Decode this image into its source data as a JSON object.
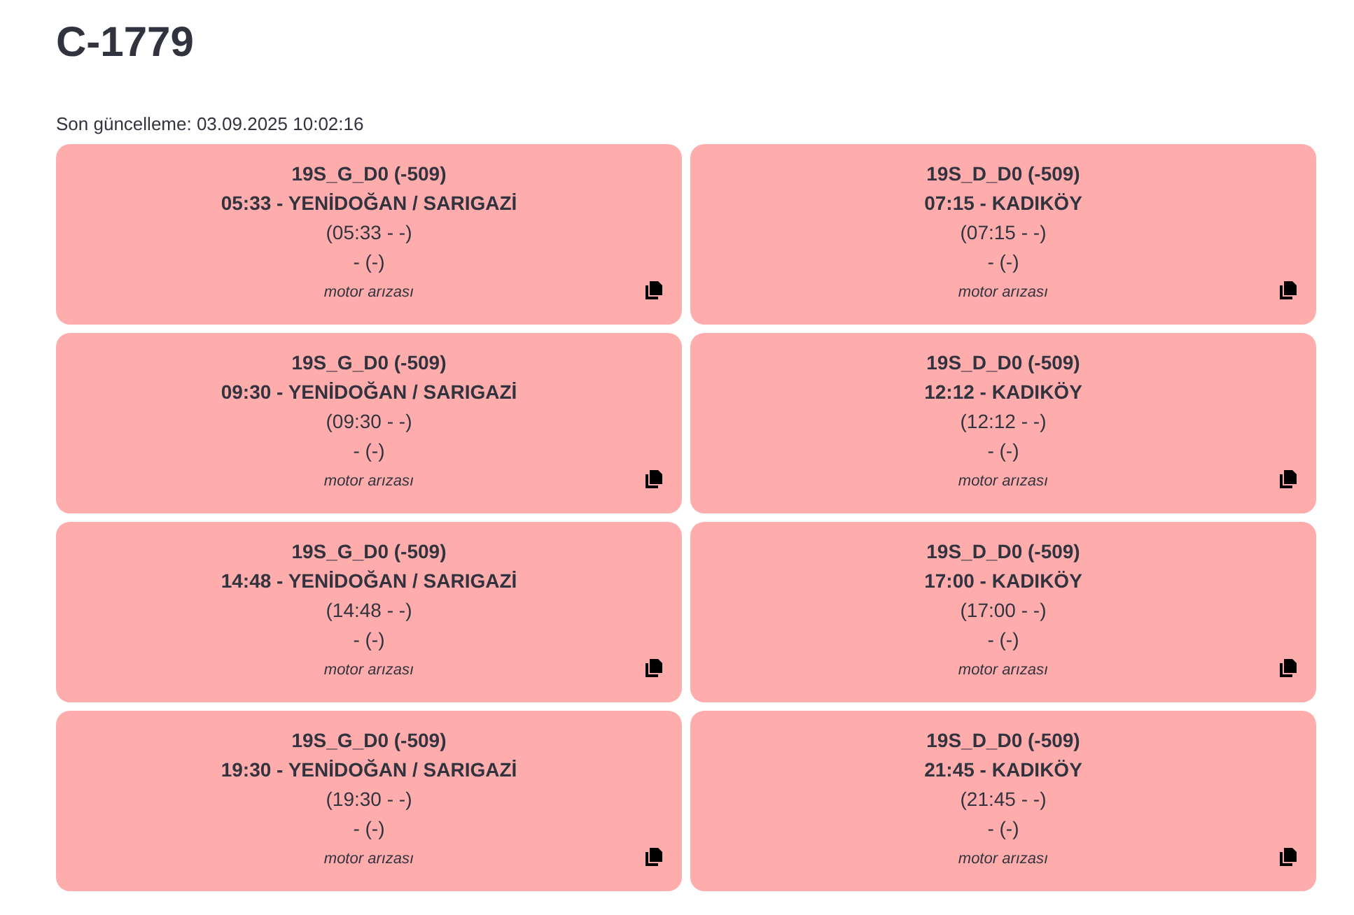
{
  "title": "C-1779",
  "last_update": "Son güncelleme: 03.09.2025 10:02:16",
  "cards": [
    {
      "code": "19S_G_D0 (-509)",
      "route": "05:33 - YENİDOĞAN / SARIGAZİ",
      "times": "(05:33 - -)",
      "detail": "- (-)",
      "note": "motor arızası"
    },
    {
      "code": "19S_D_D0 (-509)",
      "route": "07:15 - KADIKÖY",
      "times": "(07:15 - -)",
      "detail": "- (-)",
      "note": "motor arızası"
    },
    {
      "code": "19S_G_D0 (-509)",
      "route": "09:30 - YENİDOĞAN / SARIGAZİ",
      "times": "(09:30 - -)",
      "detail": "- (-)",
      "note": "motor arızası"
    },
    {
      "code": "19S_D_D0 (-509)",
      "route": "12:12 - KADIKÖY",
      "times": "(12:12 - -)",
      "detail": "- (-)",
      "note": "motor arızası"
    },
    {
      "code": "19S_G_D0 (-509)",
      "route": "14:48 - YENİDOĞAN / SARIGAZİ",
      "times": "(14:48 - -)",
      "detail": "- (-)",
      "note": "motor arızası"
    },
    {
      "code": "19S_D_D0 (-509)",
      "route": "17:00 - KADIKÖY",
      "times": "(17:00 - -)",
      "detail": "- (-)",
      "note": "motor arızası"
    },
    {
      "code": "19S_G_D0 (-509)",
      "route": "19:30 - YENİDOĞAN / SARIGAZİ",
      "times": "(19:30 - -)",
      "detail": "- (-)",
      "note": "motor arızası"
    },
    {
      "code": "19S_D_D0 (-509)",
      "route": "21:45 - KADIKÖY",
      "times": "(21:45 - -)",
      "detail": "- (-)",
      "note": "motor arızası"
    }
  ]
}
